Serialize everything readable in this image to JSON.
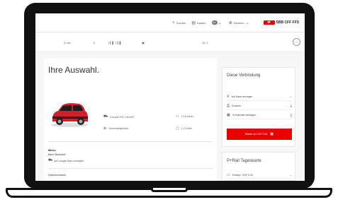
{
  "nav": {
    "search": "Suchen",
    "buy": "Kaufen",
    "account_badge": "BO",
    "language": "Deutsch",
    "logo_text": "SBB CFF FFS"
  },
  "timeline": {
    "t1": "3 min",
    "t2": "0",
    "t3": "1 ▎▌ 2 ▎▌",
    "t4": "▣",
    "t5": "GL 0",
    "menu": "…"
  },
  "main": {
    "title": "Ihre Auswahl.",
    "features": {
      "model": "Renault ZOE 240/400",
      "persons": "4 Personen",
      "transmission": "Automatikgetriebe",
      "luggage": "1-2 Koffer"
    },
    "location": {
      "category": "Micro",
      "station": "Bern Bahnhof",
      "maps_link": "auf Google Maps anzeigen"
    },
    "subtotal_label": "Zwischentotal"
  },
  "connection": {
    "title": "Diese Verbindung",
    "rows": [
      {
        "label": "Auf Karte anzeigen",
        "action": "→"
      },
      {
        "label": "Drucken",
        "action": "⤓"
      },
      {
        "label": "In Kalender eintragen",
        "action": "⤓"
      }
    ],
    "ticket_button": "Billette ab CHF 0.00"
  },
  "railcard": {
    "title": "P+Rail Tageskarte",
    "row_label": "Schwyz, CHF 5.00",
    "row_action": "→"
  },
  "colors": {
    "brand_red": "#eb0000",
    "car_red": "#d31f2a"
  }
}
